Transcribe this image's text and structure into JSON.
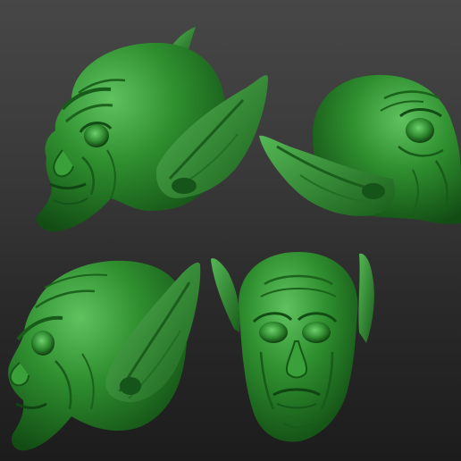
{
  "scene": {
    "subject": "goblin-head-sculpt",
    "material_color": "#2e8b2e",
    "highlight_color": "#5cc05c",
    "shadow_color": "#114d14",
    "background_top": "#474747",
    "background_bottom": "#1c1c1c",
    "views": [
      "left-profile",
      "right-profile",
      "three-quarter-left",
      "front"
    ]
  }
}
